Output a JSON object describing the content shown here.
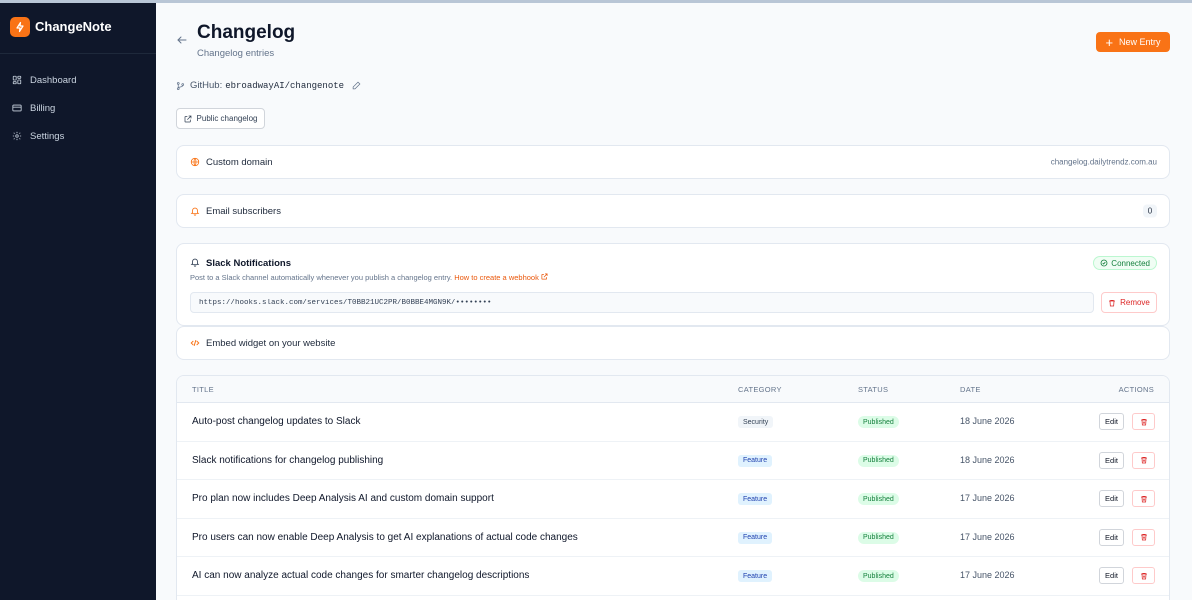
{
  "app": {
    "name": "ChangeNote",
    "brand_color": "#f97316",
    "sidebar_color": "#0f172a"
  },
  "sidebar": {
    "items": [
      {
        "label": "Dashboard",
        "icon": "grid-icon"
      },
      {
        "label": "Billing",
        "icon": "credit-card-icon"
      },
      {
        "label": "Settings",
        "icon": "gear-icon"
      }
    ]
  },
  "header": {
    "title": "Changelog",
    "subtitle": "Changelog entries",
    "new_entry_label": "New Entry"
  },
  "github": {
    "label": "GitHub:",
    "repo": "ebroadwayAI/changenote"
  },
  "public_changelog_label": "Public changelog",
  "custom_domain": {
    "label": "Custom domain",
    "value": "changelog.dailytrendz.com.au"
  },
  "email_subscribers": {
    "label": "Email subscribers",
    "count": "0"
  },
  "slack": {
    "title": "Slack Notifications",
    "description": "Post to a Slack channel automatically whenever you publish a changelog entry.",
    "link_label": "How to create a webhook",
    "status": "Connected",
    "webhook_value": "https://hooks.slack.com/services/T0BB21UC2PR/B0BBE4MGN9K/••••••••",
    "remove_label": "Remove"
  },
  "embed_widget": {
    "label": "Embed widget on your website"
  },
  "table": {
    "columns": {
      "title": "TITLE",
      "category": "CATEGORY",
      "status": "STATUS",
      "date": "DATE",
      "actions": "ACTIONS"
    },
    "edit_label": "Edit",
    "rows": [
      {
        "title": "Auto-post changelog updates to Slack",
        "category": "Security",
        "status": "Published",
        "date": "18 June 2026"
      },
      {
        "title": "Slack notifications for changelog publishing",
        "category": "Feature",
        "status": "Published",
        "date": "18 June 2026"
      },
      {
        "title": "Pro plan now includes Deep Analysis AI and custom domain support",
        "category": "Feature",
        "status": "Published",
        "date": "17 June 2026"
      },
      {
        "title": "Pro users can now enable Deep Analysis to get AI explanations of actual code changes",
        "category": "Feature",
        "status": "Published",
        "date": "17 June 2026"
      },
      {
        "title": "AI can now analyze actual code changes for smarter changelog descriptions",
        "category": "Feature",
        "status": "Published",
        "date": "17 June 2026"
      }
    ]
  }
}
